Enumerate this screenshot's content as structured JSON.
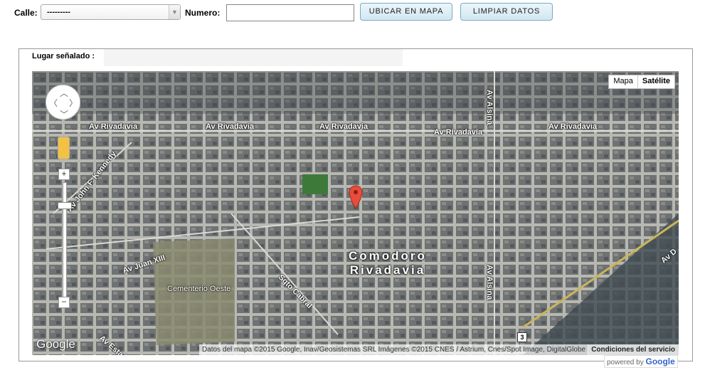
{
  "form": {
    "calle_label": "Calle:",
    "calle_selected": "---------",
    "numero_label": "Numero:",
    "numero_value": "",
    "ubicar_button": "UBICAR EN MAPA",
    "limpiar_button": "LIMPIAR DATOS"
  },
  "panel": {
    "lugar_label": "Lugar señalado :",
    "lugar_value": ""
  },
  "map": {
    "type_buttons": [
      "Mapa",
      "Satélite"
    ],
    "selected_type": "Satélite",
    "city_label_line1": "Comodoro",
    "city_label_line2": "Rivadavia",
    "street_labels": {
      "rivadavia": "Av Rivadavia",
      "kennedy": "Av John F. Kennedy",
      "juan23": "Av Juan XIII",
      "sgto_cabral": "Sgto Cabral",
      "alsina": "Av Alsina",
      "estado": "Av Estado",
      "av_d": "Av D"
    },
    "poi_label": "Cementerio Oeste",
    "route_shield": "3",
    "google_logo": "Google",
    "attribution": "Datos del mapa ©2015 Google, Inav/Geosistemas SRL Imágenes ©2015 CNES / Astrium, Cnes/Spot Image, DigitalGlobe",
    "terms": "Condiciones del servicio",
    "powered_by_text": "powered by",
    "powered_by_brand": "Google",
    "zoom_in": "+",
    "zoom_out": "−",
    "marker_color": "#e74c3c"
  }
}
